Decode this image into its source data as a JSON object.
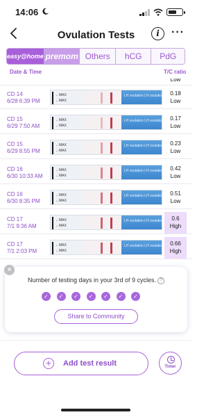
{
  "status_bar": {
    "time": "14:06",
    "moon_icon": "moon-icon",
    "signal_icon": "signal-icon",
    "wifi_icon": "wifi-icon",
    "battery_icon": "battery-icon"
  },
  "nav": {
    "title": "Ovulation Tests",
    "back_icon": "chevron-left-icon",
    "info_icon": "info-icon",
    "more_icon": "more-icon",
    "info_glyph": "i",
    "more_glyph": "···"
  },
  "tabs": [
    {
      "label": "easy@home"
    },
    {
      "label": "premom"
    },
    {
      "label": "Others"
    },
    {
      "label": "hCG"
    },
    {
      "label": "PdG"
    }
  ],
  "table": {
    "header_left": "Date & Time",
    "header_right": "T/C ratio",
    "strip_max_label": "←MAX",
    "strip_lh_text": "LH  ovulation  LH  ovulation",
    "rows": [
      {
        "cd": "CD 14",
        "datetime": "6/28 6:39 PM",
        "ratio": "0.18",
        "level": "Low"
      },
      {
        "cd": "CD 15",
        "datetime": "6/29 7:50 AM",
        "ratio": "0.17",
        "level": "Low"
      },
      {
        "cd": "CD 15",
        "datetime": "6/29 8:55 PM",
        "ratio": "0.23",
        "level": "Low"
      },
      {
        "cd": "CD 16",
        "datetime": "6/30 10:33 AM",
        "ratio": "0.42",
        "level": "Low"
      },
      {
        "cd": "CD 16",
        "datetime": "6/30 8:35 PM",
        "ratio": "0.51",
        "level": "Low"
      },
      {
        "cd": "CD 17",
        "datetime": "7/1 9:36 AM",
        "ratio": "0.6",
        "level": "High"
      },
      {
        "cd": "CD 17",
        "datetime": "7/1 2:03 PM",
        "ratio": "0.66",
        "level": "High"
      }
    ],
    "partial_top_ratio": "Low"
  },
  "card": {
    "message": "Number of testing days in your 3rd of 9 cycles.",
    "help_glyph": "?",
    "close_glyph": "×",
    "check_glyph": "✓",
    "days_checked": 7,
    "share_label": "Share to Community"
  },
  "actions": {
    "add_glyph": "+",
    "add_label": "Add test result",
    "timer_label": "Timer"
  },
  "colors": {
    "accent": "#a860d9",
    "accent_dark": "#8d4ec7",
    "high_bg": "#eddcfa"
  }
}
